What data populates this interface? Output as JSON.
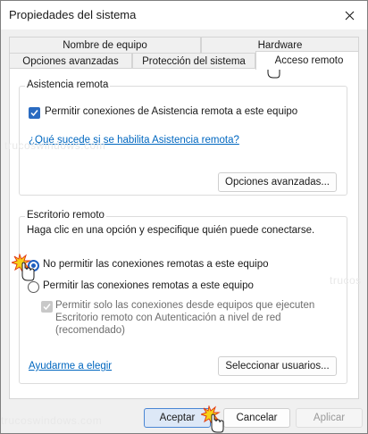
{
  "window": {
    "title": "Propiedades del sistema"
  },
  "tabs": {
    "row1": [
      {
        "label": "Nombre de equipo"
      },
      {
        "label": "Hardware"
      }
    ],
    "row2": [
      {
        "label": "Opciones avanzadas"
      },
      {
        "label": "Protección del sistema"
      },
      {
        "label": "Acceso remoto",
        "active": true
      }
    ]
  },
  "remote_assistance": {
    "group_title": "Asistencia remota",
    "allow_label": "Permitir conexiones de Asistencia remota a este equipo",
    "allow_checked": true,
    "help_link": "¿Qué sucede si se habilita Asistencia remota?",
    "advanced_button": "Opciones avanzadas..."
  },
  "remote_desktop": {
    "group_title": "Escritorio remoto",
    "instruction": "Haga clic en una opción y especifique quién puede conectarse.",
    "option_deny": "No permitir las conexiones remotas a este equipo",
    "option_allow": "Permitir las conexiones remotas a este equipo",
    "selected": "option_deny",
    "nla_line1": "Permitir solo las conexiones desde equipos que ejecuten",
    "nla_line2": "Escritorio remoto con Autenticación a nivel de red",
    "nla_line3": "(recomendado)",
    "nla_checked": true,
    "help_link": "Ayudarme a elegir",
    "select_users_button": "Seleccionar usuarios..."
  },
  "footer": {
    "ok": "Aceptar",
    "cancel": "Cancelar",
    "apply": "Aplicar"
  },
  "watermark": {
    "text": "trucoswindows.com",
    "text_short": "trucos"
  },
  "colors": {
    "accent": "#2a6bc1",
    "link": "#0067c0",
    "pointer_flash": "#f7d117"
  },
  "icons": {
    "close": "close-icon",
    "check": "check-icon",
    "pointer": "hand-pointer-icon",
    "click_flash": "click-flash-icon"
  }
}
